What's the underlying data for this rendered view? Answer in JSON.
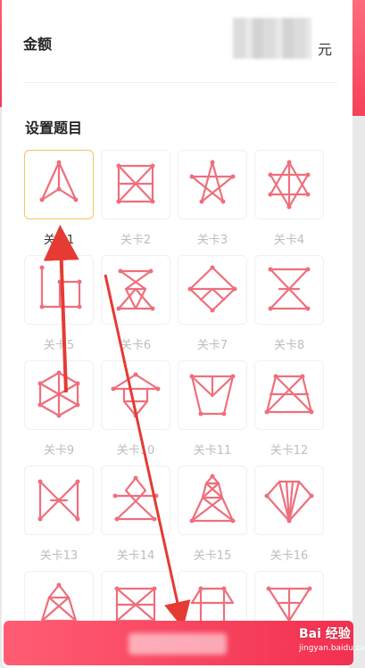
{
  "amount": {
    "label": "金额",
    "unit": "元"
  },
  "section_title": "设置题目",
  "levels": [
    {
      "label": "关卡1",
      "icon": "triangle-star-pattern-icon",
      "selected": true
    },
    {
      "label": "关卡2",
      "icon": "box-x-pattern-icon",
      "selected": false
    },
    {
      "label": "关卡3",
      "icon": "pentagram-pattern-icon",
      "selected": false
    },
    {
      "label": "关卡4",
      "icon": "hexagram-pattern-icon",
      "selected": false
    },
    {
      "label": "关卡5",
      "icon": "step-pattern-icon",
      "selected": false
    },
    {
      "label": "关卡6",
      "icon": "hourglass-triangle-pattern-icon",
      "selected": false
    },
    {
      "label": "关卡7",
      "icon": "diamond-pattern-icon",
      "selected": false
    },
    {
      "label": "关卡8",
      "icon": "hourglass-pattern-icon",
      "selected": false
    },
    {
      "label": "关卡9",
      "icon": "hexagon-web-pattern-icon",
      "selected": false
    },
    {
      "label": "关卡10",
      "icon": "pagoda-pattern-icon",
      "selected": false
    },
    {
      "label": "关卡11",
      "icon": "funnel-pattern-icon",
      "selected": false
    },
    {
      "label": "关卡12",
      "icon": "trapezoid-mesh-pattern-icon",
      "selected": false
    },
    {
      "label": "关卡13",
      "icon": "bowtie-pattern-icon",
      "selected": false
    },
    {
      "label": "关卡14",
      "icon": "kite-pattern-icon",
      "selected": false
    },
    {
      "label": "关卡15",
      "icon": "tower-pattern-icon",
      "selected": false
    },
    {
      "label": "关卡16",
      "icon": "fan-pattern-icon",
      "selected": false
    },
    {
      "label": "",
      "icon": "tower-small-pattern-icon",
      "selected": false
    },
    {
      "label": "",
      "icon": "crossed-box-pattern-icon",
      "selected": false
    },
    {
      "label": "",
      "icon": "arch-pattern-icon",
      "selected": false
    },
    {
      "label": "",
      "icon": "fan-small-pattern-icon",
      "selected": false
    }
  ],
  "colors": {
    "accent": "#ee6f7c",
    "selected_border": "#f5c462",
    "bar": "#f2304f",
    "arrow": "#e53b32"
  },
  "watermark": {
    "main": "Bai 经验",
    "sub": "jingyan.baidu.com"
  }
}
